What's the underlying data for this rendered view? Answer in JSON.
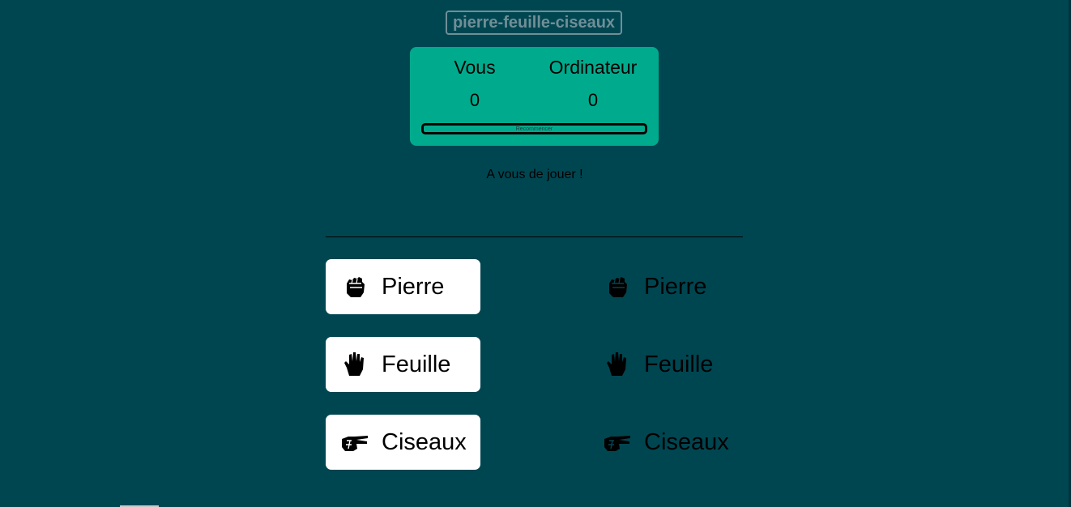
{
  "title": "pierre-feuille-ciseaux",
  "scoreboard": {
    "you_label": "Vous",
    "cpu_label": "Ordinateur",
    "you_score": "0",
    "cpu_score": "0",
    "restart_label": "Recommencer"
  },
  "message": "A vous de jouer !",
  "player_choices": [
    {
      "label": "Pierre",
      "icon": "fist-icon"
    },
    {
      "label": "Feuille",
      "icon": "hand-icon"
    },
    {
      "label": "Ciseaux",
      "icon": "scissors-hand-icon"
    }
  ],
  "cpu_choices": [
    {
      "label": "Pierre",
      "icon": "fist-icon"
    },
    {
      "label": "Feuille",
      "icon": "hand-icon"
    },
    {
      "label": "Ciseaux",
      "icon": "scissors-hand-icon"
    }
  ],
  "colors": {
    "background": "#004651",
    "scoreboard": "#00ab8d",
    "button": "#ffffff",
    "title": "#6f8f97"
  }
}
